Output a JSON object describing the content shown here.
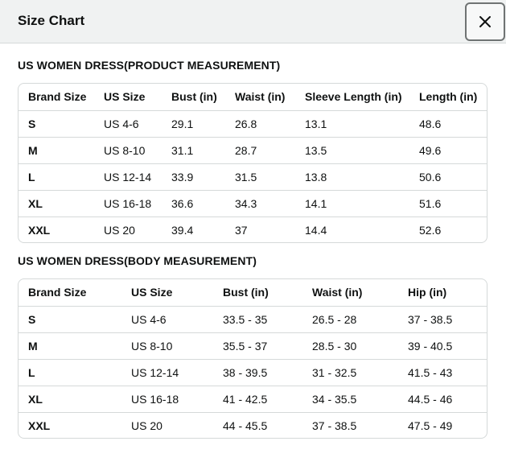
{
  "header": {
    "title": "Size Chart",
    "close_icon": "close-icon"
  },
  "product_table": {
    "title": "US WOMEN DRESS(PRODUCT MEASUREMENT)",
    "columns": [
      "Brand Size",
      "US Size",
      "Bust (in)",
      "Waist (in)",
      "Sleeve Length (in)",
      "Length (in)"
    ],
    "rows": [
      [
        "S",
        "US 4-6",
        "29.1",
        "26.8",
        "13.1",
        "48.6"
      ],
      [
        "M",
        "US 8-10",
        "31.1",
        "28.7",
        "13.5",
        "49.6"
      ],
      [
        "L",
        "US 12-14",
        "33.9",
        "31.5",
        "13.8",
        "50.6"
      ],
      [
        "XL",
        "US 16-18",
        "36.6",
        "34.3",
        "14.1",
        "51.6"
      ],
      [
        "XXL",
        "US 20",
        "39.4",
        "37",
        "14.4",
        "52.6"
      ]
    ]
  },
  "body_table": {
    "title": "US WOMEN DRESS(BODY MEASUREMENT)",
    "columns": [
      "Brand Size",
      "US Size",
      "Bust (in)",
      "Waist (in)",
      "Hip (in)"
    ],
    "rows": [
      [
        "S",
        "US 4-6",
        "33.5 - 35",
        "26.5 - 28",
        "37 - 38.5"
      ],
      [
        "M",
        "US 8-10",
        "35.5 - 37",
        "28.5 - 30",
        "39 - 40.5"
      ],
      [
        "L",
        "US 12-14",
        "38 - 39.5",
        "31 - 32.5",
        "41.5 - 43"
      ],
      [
        "XL",
        "US 16-18",
        "41 - 42.5",
        "34 - 35.5",
        "44.5 - 46"
      ],
      [
        "XXL",
        "US 20",
        "44 - 45.5",
        "37 - 38.5",
        "47.5 - 49"
      ]
    ]
  }
}
